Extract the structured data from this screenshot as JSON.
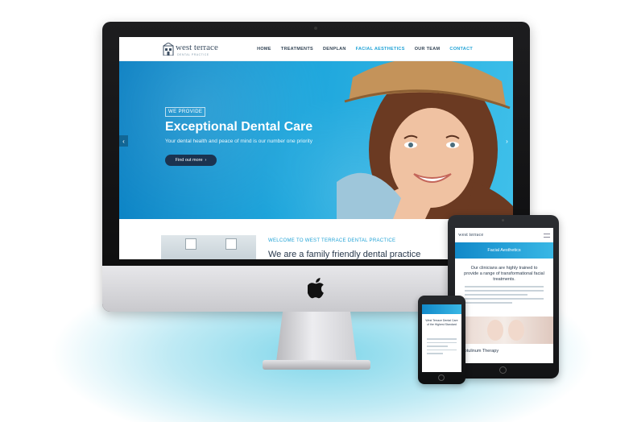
{
  "desktop": {
    "logo": {
      "name": "west terrace",
      "tagline": "DENTAL PRACTICE"
    },
    "nav": [
      {
        "label": "HOME"
      },
      {
        "label": "TREATMENTS"
      },
      {
        "label": "DENPLAN"
      },
      {
        "label": "FACIAL AESTHETICS"
      },
      {
        "label": "OUR TEAM"
      },
      {
        "label": "CONTACT"
      }
    ],
    "hero": {
      "tag": "WE PROVIDE",
      "title": "Exceptional Dental Care",
      "subtitle": "Your dental health and peace of mind is our number one priority",
      "button": "Find out more",
      "prev_icon": "chevron-left",
      "next_icon": "chevron-right"
    },
    "welcome": {
      "kicker": "WELCOME TO WEST TERRACE DENTAL PRACTICE",
      "title": "We are a family friendly dental practice"
    }
  },
  "tablet": {
    "logo": "west terrace",
    "band": "Facial Aesthetics",
    "heading": "Our clinicians are highly trained to provide a range of transformational facial treatments.",
    "caption": "Botulinum Therapy"
  },
  "phone": {
    "heading": "West Terrace Dental Care of the Highest Standard"
  },
  "colors": {
    "accent": "#1fa2d6",
    "hero_dark": "#0a7fc2",
    "button": "#1b3350",
    "text_dark": "#2a3a4d"
  }
}
